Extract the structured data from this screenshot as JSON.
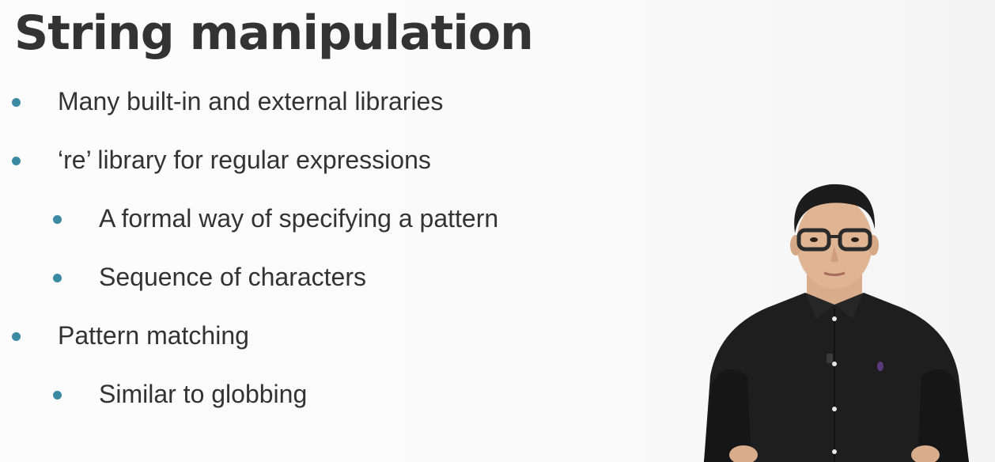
{
  "slide": {
    "title": "String manipulation",
    "bullets": [
      {
        "level": 1,
        "text": "Many built-in and external libraries"
      },
      {
        "level": 1,
        "text": "‘re’ library for regular expressions"
      },
      {
        "level": 2,
        "text": "A formal way of specifying a pattern"
      },
      {
        "level": 2,
        "text": "Sequence of characters"
      },
      {
        "level": 1,
        "text": "Pattern matching"
      },
      {
        "level": 2,
        "text": "Similar to globbing"
      }
    ]
  },
  "colors": {
    "background": "#fbfbfb",
    "text": "#333333",
    "bullet_accent": "#3a8aa3"
  },
  "presenter": {
    "image": "presenter-photo"
  }
}
